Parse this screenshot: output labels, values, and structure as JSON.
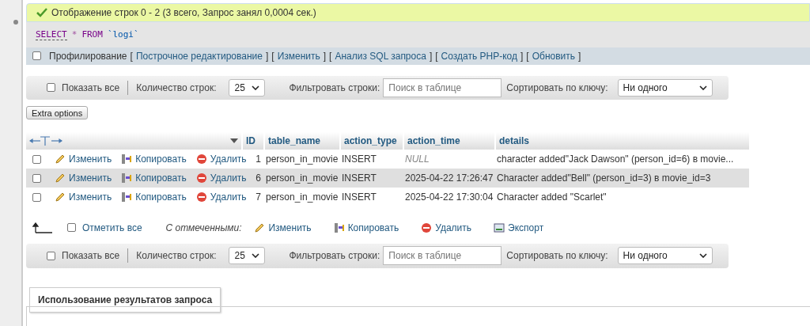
{
  "success": {
    "text": "Отображение строк 0 - 2 (3 всего, Запрос занял 0,0004 сек.)"
  },
  "sql": {
    "keyword": "SELECT",
    "star": "*",
    "from": "FROM",
    "table": "`logi`"
  },
  "profiling": {
    "label": "Профилирование",
    "checked": false,
    "links": [
      {
        "open": "[",
        "label": "Построчное редактирование",
        "close": "]"
      },
      {
        "open": "[",
        "label": "Изменить",
        "close": "]"
      },
      {
        "open": "[",
        "label": "Анализ SQL запроса",
        "close": "]"
      },
      {
        "open": "[",
        "label": "Создать PHP-код",
        "close": "]"
      },
      {
        "open": "[",
        "label": "Обновить",
        "close": "]"
      }
    ]
  },
  "nav_top": {
    "show_all": "Показать все",
    "show_all_checked": false,
    "rows_label": "Количество строк:",
    "rows_value": "25",
    "filter_label": "Фильтровать строки:",
    "filter_placeholder": "Поиск в таблице",
    "sort_label": "Сортировать по ключу:",
    "sort_value": "Ни одного"
  },
  "extra_options": "Extra options",
  "table": {
    "columns": [
      "ID",
      "table_name",
      "action_type",
      "action_time",
      "details"
    ],
    "rows": [
      {
        "selected": false,
        "highlighted": false,
        "actions": [
          "Изменить",
          "Копировать",
          "Удалить"
        ],
        "id": "1",
        "table_name": "person_in_movie",
        "action_type": "INSERT",
        "action_time": "NULL",
        "time_is_null": true,
        "details": "character added\"Jack Dawson\" (person_id=6) в movie..."
      },
      {
        "selected": false,
        "highlighted": true,
        "actions": [
          "Изменить",
          "Копировать",
          "Удалить"
        ],
        "id": "6",
        "table_name": "person_in_movie",
        "action_type": "INSERT",
        "action_time": "2025-04-22 17:26:47",
        "time_is_null": false,
        "details": "Character added\"Bell\" (person_id=3) в movie_id=3"
      },
      {
        "selected": false,
        "highlighted": false,
        "actions": [
          "Изменить",
          "Копировать",
          "Удалить"
        ],
        "id": "7",
        "table_name": "person_in_movie",
        "action_type": "INSERT",
        "action_time": "2025-04-22 17:30:04",
        "time_is_null": false,
        "details": "Character added \"Scarlet\""
      }
    ]
  },
  "bulk": {
    "check_all": "Отметить все",
    "check_all_checked": false,
    "with_selected": "С отмеченными:",
    "actions": [
      {
        "kind": "edit",
        "label": "Изменить"
      },
      {
        "kind": "copy",
        "label": "Копировать"
      },
      {
        "kind": "delete",
        "label": "Удалить"
      },
      {
        "kind": "export",
        "label": "Экспорт"
      }
    ]
  },
  "nav_bottom": {
    "show_all": "Показать все",
    "show_all_checked": false,
    "rows_label": "Количество строк:",
    "rows_value": "25",
    "filter_label": "Фильтровать строки:",
    "filter_placeholder": "Поиск в таблице",
    "sort_label": "Сортировать по ключу:",
    "sort_value": "Ни одного"
  },
  "query_results": {
    "title": "Использование результатов запроса"
  }
}
